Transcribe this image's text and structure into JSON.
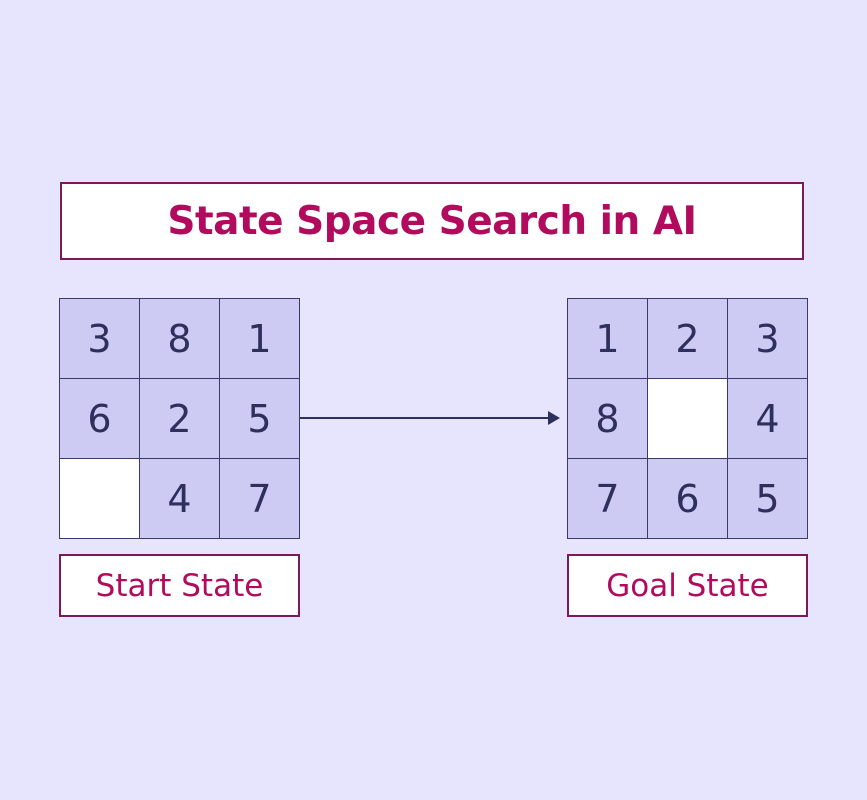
{
  "title": "State Space Search in AI",
  "start_state": {
    "label": "Start State",
    "tiles": [
      "3",
      "8",
      "1",
      "6",
      "2",
      "5",
      "",
      "4",
      "7"
    ]
  },
  "goal_state": {
    "label": "Goal State",
    "tiles": [
      "1",
      "2",
      "3",
      "8",
      "",
      "4",
      "7",
      "6",
      "5"
    ]
  },
  "colors": {
    "background": "#e6e5fd",
    "tile": "#cdcbf4",
    "blank_tile": "#ffffff",
    "tile_text": "#2e2f5c",
    "accent_text": "#b00b5c",
    "accent_border": "#7a1a5c",
    "arrow": "#2e2f5c"
  }
}
